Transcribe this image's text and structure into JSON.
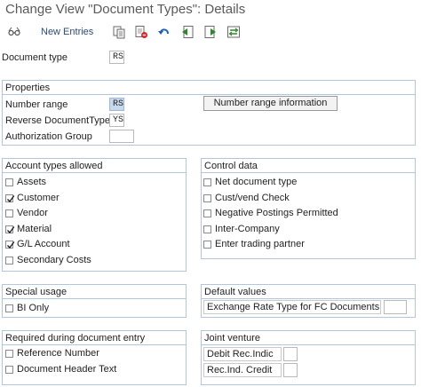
{
  "window": {
    "title": "Change View \"Document Types\": Details"
  },
  "toolbar": {
    "new_entries_label": "New Entries"
  },
  "header": {
    "doc_type_label": "Document type",
    "doc_type_value": "RS"
  },
  "properties": {
    "title": "Properties",
    "number_range_label": "Number range",
    "number_range_value": "RS",
    "number_range_button": "Number range information",
    "reverse_doc_type_label": "Reverse DocumentType",
    "reverse_doc_type_value": "YS",
    "authorization_group_label": "Authorization Group",
    "authorization_group_value": ""
  },
  "account_types": {
    "title": "Account types allowed",
    "items": [
      {
        "label": "Assets",
        "checked": false
      },
      {
        "label": "Customer",
        "checked": true
      },
      {
        "label": "Vendor",
        "checked": false
      },
      {
        "label": "Material",
        "checked": true
      },
      {
        "label": "G/L Account",
        "checked": true
      },
      {
        "label": "Secondary Costs",
        "checked": false
      }
    ]
  },
  "control_data": {
    "title": "Control data",
    "items": [
      {
        "label": "Net document type",
        "checked": false
      },
      {
        "label": "Cust/vend Check",
        "checked": false
      },
      {
        "label": "Negative Postings Permitted",
        "checked": false
      },
      {
        "label": "Inter-Company",
        "checked": false
      },
      {
        "label": "Enter trading partner",
        "checked": false
      }
    ]
  },
  "special_usage": {
    "title": "Special usage",
    "items": [
      {
        "label": "BI Only",
        "checked": false
      }
    ]
  },
  "default_values": {
    "title": "Default values",
    "exchange_rate_label": "Exchange Rate Type for FC Documents",
    "exchange_rate_value": ""
  },
  "required_entry": {
    "title": "Required during document entry",
    "items": [
      {
        "label": "Reference Number",
        "checked": false
      },
      {
        "label": "Document Header Text",
        "checked": false
      }
    ]
  },
  "joint_venture": {
    "title": "Joint venture",
    "debit_label": "Debit Rec.Indic",
    "debit_value": "",
    "credit_label": "Rec.Ind. Credit",
    "credit_value": ""
  },
  "colors": {
    "accent": "#2a4a78",
    "group_border": "#b3c6dd",
    "highlight": "#c7d9ef"
  }
}
